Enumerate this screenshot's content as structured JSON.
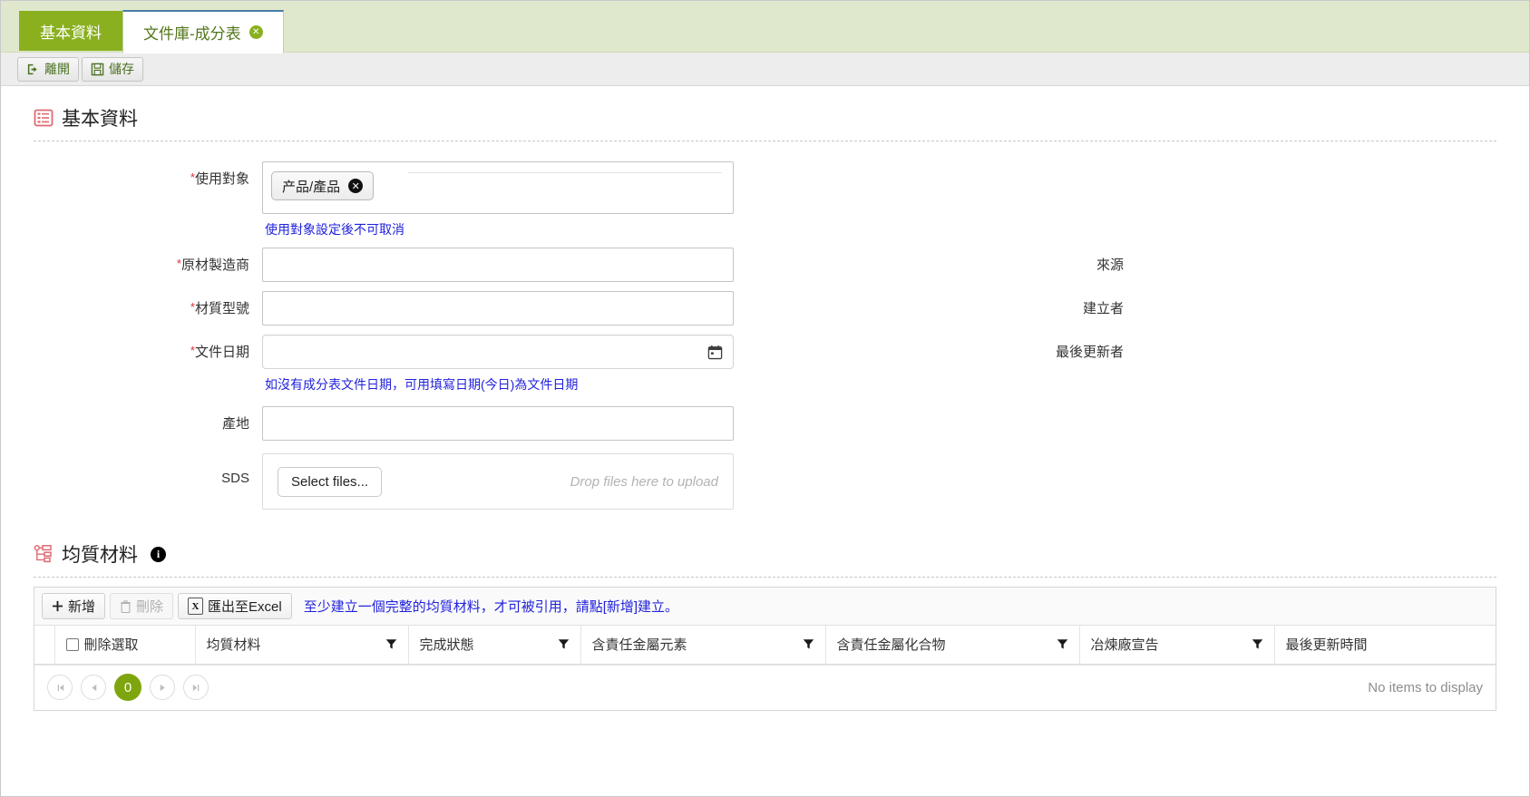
{
  "tabs": [
    {
      "label": "基本資料",
      "closable": false,
      "state": "inactive-green"
    },
    {
      "label": "文件庫-成分表",
      "closable": true,
      "state": "selected"
    }
  ],
  "toolbar": {
    "leave_label": "離開",
    "save_label": "儲存",
    "leave_icon": "exit-icon",
    "save_icon": "floppy-disk-icon"
  },
  "basic_section": {
    "title": "基本資料",
    "icon": "list-form-icon"
  },
  "form": {
    "use_target": {
      "label": "使用對象",
      "required": true,
      "token": "产品/產品",
      "token_remove_icon": "remove-token-icon",
      "hint": "使用對象設定後不可取消"
    },
    "manufacturer": {
      "label": "原材製造商",
      "required": true,
      "value": "",
      "right_label": "來源",
      "right_value": ""
    },
    "material_model": {
      "label": "材質型號",
      "required": true,
      "value": "",
      "right_label": "建立者",
      "right_value": ""
    },
    "doc_date": {
      "label": "文件日期",
      "required": true,
      "value": "",
      "calendar_icon": "calendar-icon",
      "hint": "如沒有成分表文件日期，可用填寫日期(今日)為文件日期",
      "right_label": "最後更新者",
      "right_value": ""
    },
    "origin": {
      "label": "產地",
      "required": false,
      "value": ""
    },
    "sds": {
      "label": "SDS",
      "select_files_label": "Select files...",
      "drop_message": "Drop files here to upload"
    }
  },
  "material_section": {
    "title": "均質材料",
    "icon": "hierarchy-icon",
    "info_icon": "info-icon"
  },
  "grid": {
    "toolbar": {
      "add_label": "新增",
      "add_icon": "plus-icon",
      "delete_label": "刪除",
      "delete_icon": "trash-icon",
      "delete_disabled": true,
      "export_label": "匯出至Excel",
      "export_icon": "excel-icon",
      "note": "至少建立一個完整的均質材料，才可被引用，請點[新增]建立。"
    },
    "columns": [
      {
        "header": "刪除選取",
        "filter": false,
        "checkbox": true
      },
      {
        "header": "均質材料",
        "filter": true,
        "checkbox": false
      },
      {
        "header": "完成狀態",
        "filter": true,
        "checkbox": false
      },
      {
        "header": "含責任金屬元素",
        "filter": true,
        "checkbox": false
      },
      {
        "header": "含責任金屬化合物",
        "filter": true,
        "checkbox": false
      },
      {
        "header": "冶煉廠宣告",
        "filter": true,
        "checkbox": false
      },
      {
        "header": "最後更新時間",
        "filter": false,
        "checkbox": false
      }
    ],
    "rows": [],
    "pager": {
      "first_icon": "first-page-icon",
      "prev_icon": "prev-page-icon",
      "page_number": "0",
      "next_icon": "next-page-icon",
      "last_icon": "last-page-icon",
      "empty_message": "No items to display"
    }
  },
  "colors": {
    "tab_green": "#8ab020",
    "tabstrip_bg": "#dfe8cd",
    "hint_blue": "#2222dd",
    "required_red": "#e03030",
    "section_icon_red": "#e06a72",
    "pager_active": "#7ea50e"
  }
}
